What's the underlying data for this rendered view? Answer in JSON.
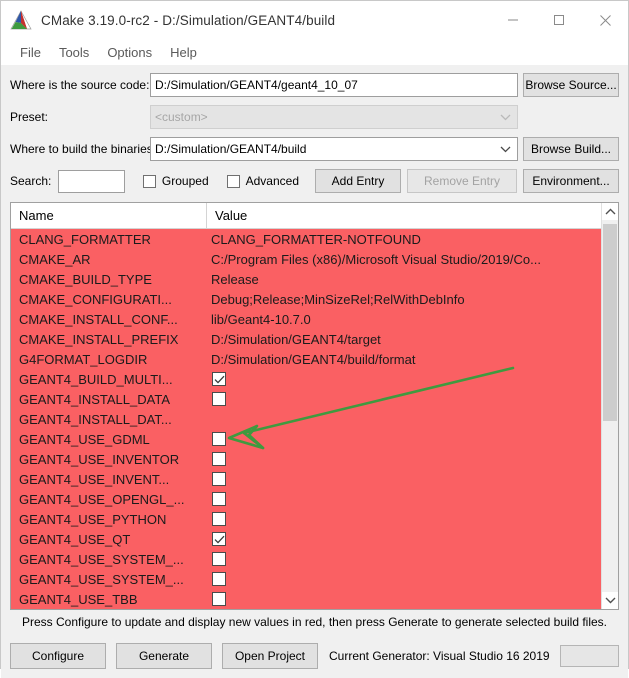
{
  "window": {
    "title": "CMake 3.19.0-rc2 - D:/Simulation/GEANT4/build",
    "logo_icon": "cmake-triangle-logo",
    "minimize_icon": "minimize-icon",
    "maximize_icon": "maximize-icon",
    "close_icon": "close-icon"
  },
  "menubar": {
    "items": [
      {
        "label": "File"
      },
      {
        "label": "Tools"
      },
      {
        "label": "Options"
      },
      {
        "label": "Help"
      }
    ]
  },
  "form": {
    "source_label": "Where is the source code:",
    "source_value": "D:/Simulation/GEANT4/geant4_10_07",
    "browse_source_label": "Browse Source...",
    "preset_label": "Preset:",
    "preset_value": "<custom>",
    "preset_arrow_icon": "chevron-down-icon",
    "build_label": "Where to build the binaries:",
    "build_value": "D:/Simulation/GEANT4/build",
    "build_arrow_icon": "chevron-down-icon",
    "browse_build_label": "Browse Build..."
  },
  "search": {
    "label": "Search:",
    "value": "",
    "placeholder": "",
    "grouped_label": "Grouped",
    "grouped_checked": false,
    "advanced_label": "Advanced",
    "advanced_checked": false,
    "add_entry_label": "Add Entry",
    "remove_entry_label": "Remove Entry",
    "remove_entry_enabled": false,
    "environment_label": "Environment..."
  },
  "table": {
    "columns": [
      "Name",
      "Value"
    ],
    "row_highlight_color": "#fa6063",
    "rows": [
      {
        "name": "CLANG_FORMATTER",
        "type": "text",
        "value": "CLANG_FORMATTER-NOTFOUND"
      },
      {
        "name": "CMAKE_AR",
        "type": "text",
        "value": "C:/Program Files (x86)/Microsoft Visual Studio/2019/Co..."
      },
      {
        "name": "CMAKE_BUILD_TYPE",
        "type": "text",
        "value": "Release"
      },
      {
        "name": "CMAKE_CONFIGURATI...",
        "type": "text",
        "value": "Debug;Release;MinSizeRel;RelWithDebInfo"
      },
      {
        "name": "CMAKE_INSTALL_CONF...",
        "type": "text",
        "value": "lib/Geant4-10.7.0"
      },
      {
        "name": "CMAKE_INSTALL_PREFIX",
        "type": "text",
        "value": "D:/Simulation/GEANT4/target"
      },
      {
        "name": "G4FORMAT_LOGDIR",
        "type": "text",
        "value": "D:/Simulation/GEANT4/build/format"
      },
      {
        "name": "GEANT4_BUILD_MULTI...",
        "type": "checkbox",
        "checked": true
      },
      {
        "name": "GEANT4_INSTALL_DATA",
        "type": "checkbox",
        "checked": false
      },
      {
        "name": "GEANT4_INSTALL_DAT...",
        "type": "text",
        "value": ""
      },
      {
        "name": "GEANT4_USE_GDML",
        "type": "checkbox",
        "checked": false
      },
      {
        "name": "GEANT4_USE_INVENTOR",
        "type": "checkbox",
        "checked": false
      },
      {
        "name": "GEANT4_USE_INVENT...",
        "type": "checkbox",
        "checked": false
      },
      {
        "name": "GEANT4_USE_OPENGL_...",
        "type": "checkbox",
        "checked": false
      },
      {
        "name": "GEANT4_USE_PYTHON",
        "type": "checkbox",
        "checked": false
      },
      {
        "name": "GEANT4_USE_QT",
        "type": "checkbox",
        "checked": true
      },
      {
        "name": "GEANT4_USE_SYSTEM_...",
        "type": "checkbox",
        "checked": false
      },
      {
        "name": "GEANT4_USE_SYSTEM_...",
        "type": "checkbox",
        "checked": false
      },
      {
        "name": "GEANT4_USE_TBB",
        "type": "checkbox",
        "checked": false
      }
    ],
    "scroll_up_icon": "chevron-up-icon",
    "scroll_down_icon": "chevron-down-icon"
  },
  "footer": {
    "hint": "Press Configure to update and display new values in red, then press Generate to generate selected build files.",
    "configure_label": "Configure",
    "generate_label": "Generate",
    "open_project_label": "Open Project",
    "generator_text": "Current Generator: Visual Studio 16 2019",
    "progress_value": ""
  },
  "annotation": {
    "arrow_color": "#3f9a3f",
    "arrow_icon": "green-arrow-annotation"
  }
}
